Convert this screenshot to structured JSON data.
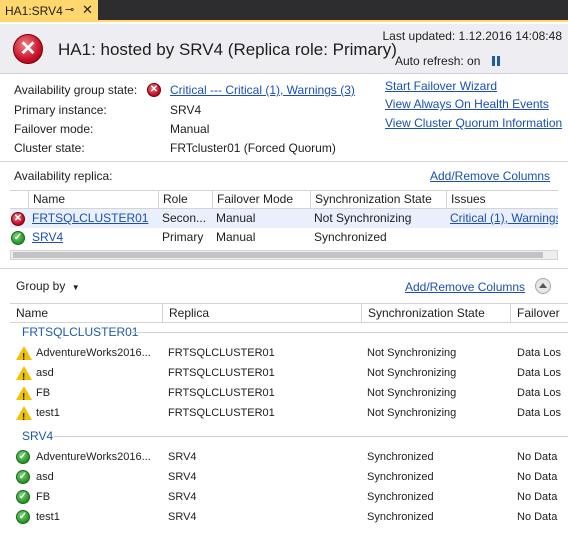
{
  "tab": {
    "label": "HA1:SRV4",
    "pin_icon": "pin-icon",
    "close_icon": "close-icon"
  },
  "header": {
    "title": "HA1: hosted by SRV4 (Replica role: Primary)",
    "last_updated": "Last updated: 1.12.2016 14:08:48",
    "auto_refresh": "Auto refresh: on"
  },
  "summary": {
    "ag_state_label": "Availability group state:",
    "ag_state_value": "Critical --- Critical (1), Warnings (3)",
    "primary_label": "Primary instance:",
    "primary_value": "SRV4",
    "failover_label": "Failover mode:",
    "failover_value": "Manual",
    "cluster_label": "Cluster state:",
    "cluster_value": "FRTcluster01 (Forced Quorum)"
  },
  "links": {
    "start_failover": "Start Failover Wizard",
    "health_events": "View Always On Health Events",
    "cluster_quorum": "View Cluster Quorum Information"
  },
  "replica": {
    "title": "Availability replica:",
    "add_remove": "Add/Remove Columns",
    "columns": [
      "Name",
      "Role",
      "Failover Mode",
      "Synchronization State",
      "Issues"
    ],
    "rows": [
      {
        "status": "error",
        "name": "FRTSQLCLUSTER01",
        "role": "Secon...",
        "failover": "Manual",
        "sync": "Not Synchronizing",
        "issues": "Critical (1), Warnings"
      },
      {
        "status": "ok",
        "name": "SRV4",
        "role": "Primary",
        "failover": "Manual",
        "sync": "Synchronized",
        "issues": ""
      }
    ]
  },
  "databases": {
    "group_by": "Group by",
    "add_remove": "Add/Remove Columns",
    "columns": [
      "Name",
      "Replica",
      "Synchronization State",
      "Failover"
    ],
    "groups": [
      {
        "name": "FRTSQLCLUSTER01",
        "rows": [
          {
            "status": "warning",
            "name": "AdventureWorks2016...",
            "replica": "FRTSQLCLUSTER01",
            "sync": "Not Synchronizing",
            "failover": "Data Los"
          },
          {
            "status": "warning",
            "name": "asd",
            "replica": "FRTSQLCLUSTER01",
            "sync": "Not Synchronizing",
            "failover": "Data Los"
          },
          {
            "status": "warning",
            "name": "FB",
            "replica": "FRTSQLCLUSTER01",
            "sync": "Not Synchronizing",
            "failover": "Data Los"
          },
          {
            "status": "warning",
            "name": "test1",
            "replica": "FRTSQLCLUSTER01",
            "sync": "Not Synchronizing",
            "failover": "Data Los"
          }
        ]
      },
      {
        "name": "SRV4",
        "rows": [
          {
            "status": "ok",
            "name": "AdventureWorks2016...",
            "replica": "SRV4",
            "sync": "Synchronized",
            "failover": "No Data"
          },
          {
            "status": "ok",
            "name": "asd",
            "replica": "SRV4",
            "sync": "Synchronized",
            "failover": "No Data"
          },
          {
            "status": "ok",
            "name": "FB",
            "replica": "SRV4",
            "sync": "Synchronized",
            "failover": "No Data"
          },
          {
            "status": "ok",
            "name": "test1",
            "replica": "SRV4",
            "sync": "Synchronized",
            "failover": "No Data"
          }
        ]
      }
    ]
  }
}
